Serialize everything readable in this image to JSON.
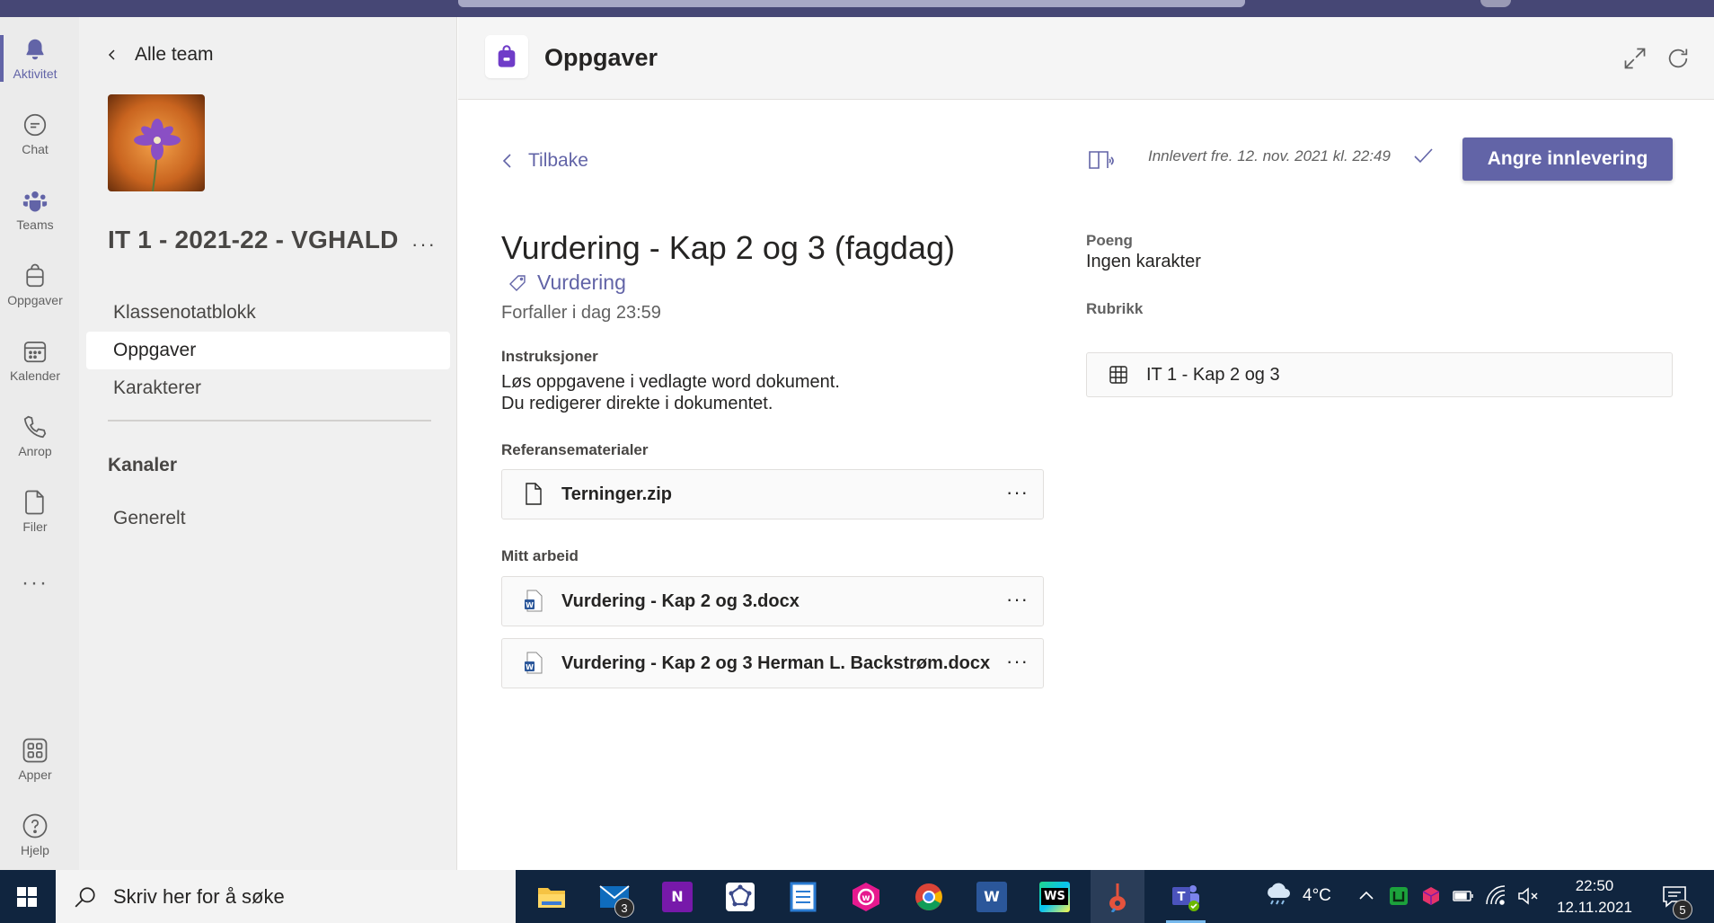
{
  "rail": {
    "items": [
      {
        "label": "Aktivitet",
        "icon": "bell-icon"
      },
      {
        "label": "Chat",
        "icon": "chat-icon"
      },
      {
        "label": "Teams",
        "icon": "teams-icon"
      },
      {
        "label": "Oppgaver",
        "icon": "assignments-icon"
      },
      {
        "label": "Kalender",
        "icon": "calendar-icon"
      },
      {
        "label": "Anrop",
        "icon": "phone-icon"
      },
      {
        "label": "Filer",
        "icon": "file-icon"
      },
      {
        "label": "Apper",
        "icon": "apps-icon"
      },
      {
        "label": "Hjelp",
        "icon": "help-icon"
      }
    ],
    "more": "···"
  },
  "sidebar": {
    "back_label": "Alle team",
    "team_name": "IT 1 - 2021-22 - VGHALD",
    "team_more": "···",
    "nav": [
      {
        "label": "Klassenotatblokk"
      },
      {
        "label": "Oppgaver"
      },
      {
        "label": "Karakterer"
      }
    ],
    "channels_heading": "Kanaler",
    "channels": [
      {
        "label": "Generelt"
      }
    ]
  },
  "header": {
    "title": "Oppgaver"
  },
  "assignment": {
    "back_label": "Tilbake",
    "submitted_text": "Innlevert fre. 12. nov. 2021 kl. 22:49",
    "undo_button": "Angre innlevering",
    "title": "Vurdering - Kap 2 og 3 (fagdag)",
    "tag": "Vurdering",
    "due": "Forfaller i dag 23:59",
    "instructions_label": "Instruksjoner",
    "instructions_line1": "Løs oppgavene i vedlagte word dokument.",
    "instructions_line2": "Du redigerer direkte i dokumentet.",
    "reference_label": "Referansematerialer",
    "reference_files": [
      {
        "name": "Terninger.zip"
      }
    ],
    "my_work_label": "Mitt arbeid",
    "my_work_files": [
      {
        "name": "Vurdering - Kap 2 og 3.docx"
      },
      {
        "name": "Vurdering - Kap 2 og 3 Herman L. Backstrøm.docx"
      }
    ],
    "file_more": "···",
    "points_label": "Poeng",
    "points_value": "Ingen karakter",
    "rubric_label": "Rubrikk",
    "rubric_name": "IT 1 - Kap 2 og 3"
  },
  "taskbar": {
    "search_placeholder": "Skriv her for å søke",
    "mail_badge": "3",
    "weather": "4°C",
    "time": "22:50",
    "date": "12.11.2021",
    "notification_badge": "5"
  },
  "colors": {
    "accent": "#6264a7",
    "topbar": "#464775",
    "taskbar": "#10253f"
  }
}
